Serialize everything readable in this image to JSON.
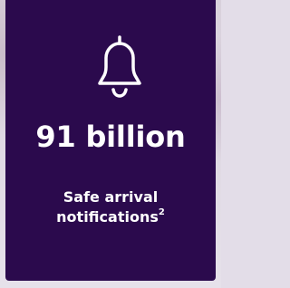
{
  "colors": {
    "card_background": "#2b0a4d",
    "text": "#ffffff"
  },
  "stat": {
    "icon": "bell-icon",
    "value": "91 billion",
    "label_line1": "Safe arrival",
    "label_line2": "notifications",
    "footnote": "2"
  }
}
